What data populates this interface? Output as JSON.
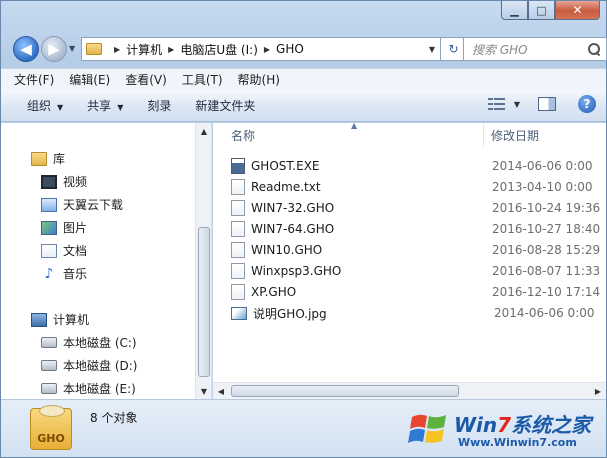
{
  "window": {
    "caption_buttons": {
      "minimize": "▁",
      "maximize": "□",
      "close": "✕"
    }
  },
  "address_bar": {
    "crumbs": [
      "计算机",
      "电脑店U盘 (I:)",
      "GHO"
    ],
    "refresh_glyph": "↻"
  },
  "search": {
    "placeholder": "搜索 GHO"
  },
  "menu": [
    "文件(F)",
    "编辑(E)",
    "查看(V)",
    "工具(T)",
    "帮助(H)"
  ],
  "toolbar": {
    "organize": "组织",
    "share": "共享",
    "burn": "刻录",
    "new_folder": "新建文件夹",
    "help": "?"
  },
  "nav_pane": {
    "libraries": "库",
    "library_items": [
      "视频",
      "天翼云下载",
      "图片",
      "文档",
      "音乐"
    ],
    "computer": "计算机",
    "drives": [
      "本地磁盘 (C:)",
      "本地磁盘 (D:)",
      "本地磁盘 (E:)"
    ]
  },
  "columns": {
    "name": "名称",
    "modified": "修改日期"
  },
  "files": [
    {
      "name": "GHOST.EXE",
      "date": "2014-06-06 0:00",
      "icon": "exe-icon"
    },
    {
      "name": "Readme.txt",
      "date": "2013-04-10 0:00",
      "icon": "text-file-icon"
    },
    {
      "name": "WIN7-32.GHO",
      "date": "2016-10-24 19:36",
      "icon": "gho-file-icon"
    },
    {
      "name": "WIN7-64.GHO",
      "date": "2016-10-27 18:40",
      "icon": "gho-file-icon"
    },
    {
      "name": "WIN10.GHO",
      "date": "2016-08-28 15:29",
      "icon": "gho-file-icon"
    },
    {
      "name": "Winxpsp3.GHO",
      "date": "2016-08-07 11:33",
      "icon": "gho-file-icon"
    },
    {
      "name": "XP.GHO",
      "date": "2016-12-10 17:14",
      "icon": "gho-file-icon"
    },
    {
      "name": "说明GHO.jpg",
      "date": "2014-06-06 0:00",
      "icon": "image-file-icon"
    }
  ],
  "details": {
    "icon_label": "GHO",
    "object_count": "8 个对象"
  },
  "watermark": {
    "brand_prefix": "Win",
    "brand_seven": "7",
    "brand_suffix": "系统之家",
    "url": "Www.Winwin7.com"
  }
}
